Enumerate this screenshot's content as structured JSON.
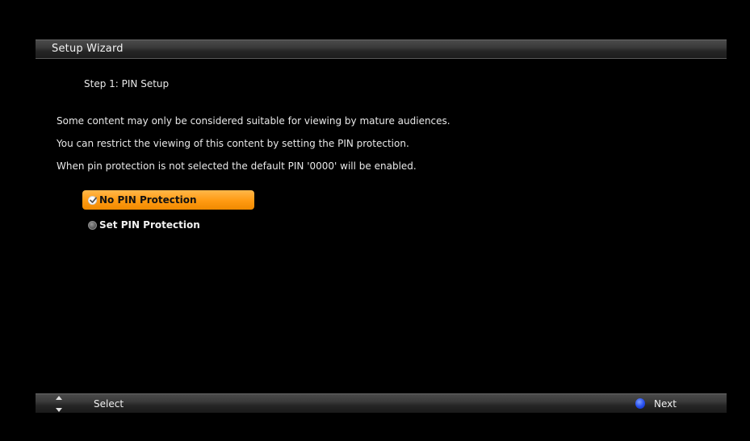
{
  "window": {
    "title": "Setup Wizard"
  },
  "step": {
    "title": "Step 1: PIN Setup"
  },
  "description": {
    "line1": "Some content may only be considered suitable for viewing by mature audiences.",
    "line2": "You can restrict the viewing of this content by setting the PIN protection.",
    "line3": "When pin protection is not selected the default PIN '0000' will be enabled."
  },
  "options": [
    {
      "label": "No PIN Protection",
      "selected": true
    },
    {
      "label": "Set PIN Protection",
      "selected": false
    }
  ],
  "footer": {
    "select_label": "Select",
    "next_label": "Next",
    "next_button_color": "blue"
  },
  "colors": {
    "highlight": "#ff9a12",
    "background": "#000000",
    "blue_button": "#2a52f0"
  }
}
